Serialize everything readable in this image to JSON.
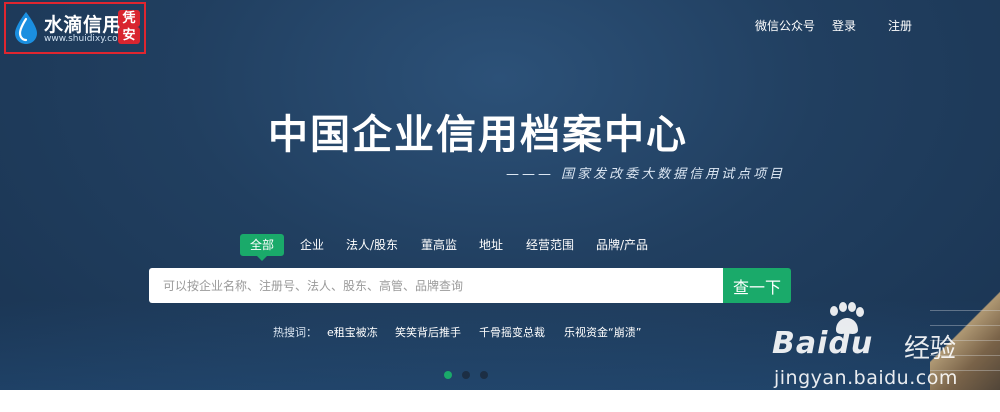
{
  "logo": {
    "title": "水滴信用",
    "url": "www.shuidixy.com",
    "seal_line1": "凭",
    "seal_line2": "安"
  },
  "nav": {
    "wechat": "微信公众号",
    "login": "登录",
    "register": "注册"
  },
  "hero": {
    "title": "中国企业信用档案中心",
    "subtitle": "——— 国家发改委大数据信用试点项目"
  },
  "tabs": [
    {
      "label": "全部",
      "active": true
    },
    {
      "label": "企业"
    },
    {
      "label": "法人/股东"
    },
    {
      "label": "董高监"
    },
    {
      "label": "地址"
    },
    {
      "label": "经营范围"
    },
    {
      "label": "品牌/产品"
    }
  ],
  "search": {
    "placeholder": "可以按企业名称、注册号、法人、股东、高管、品牌查询",
    "button_label": "查一下"
  },
  "hot": {
    "label": "热搜词：",
    "items": [
      "e租宝被冻",
      "笑笑背后推手",
      "千骨摇变总裁",
      "乐视资金“崩溃”"
    ]
  },
  "carousel": {
    "count": 3,
    "active_index": 0
  },
  "watermark": {
    "brand": "Bai",
    "brand_du": "du",
    "jingyan": "经验",
    "url": "jingyan.baidu.com"
  },
  "colors": {
    "accent": "#1aaa6a",
    "highlight_border": "#e0262f",
    "hero_bg": "#213f60"
  },
  "icons": {
    "logo": "water-drop-icon",
    "watermark": "paw-icon"
  }
}
